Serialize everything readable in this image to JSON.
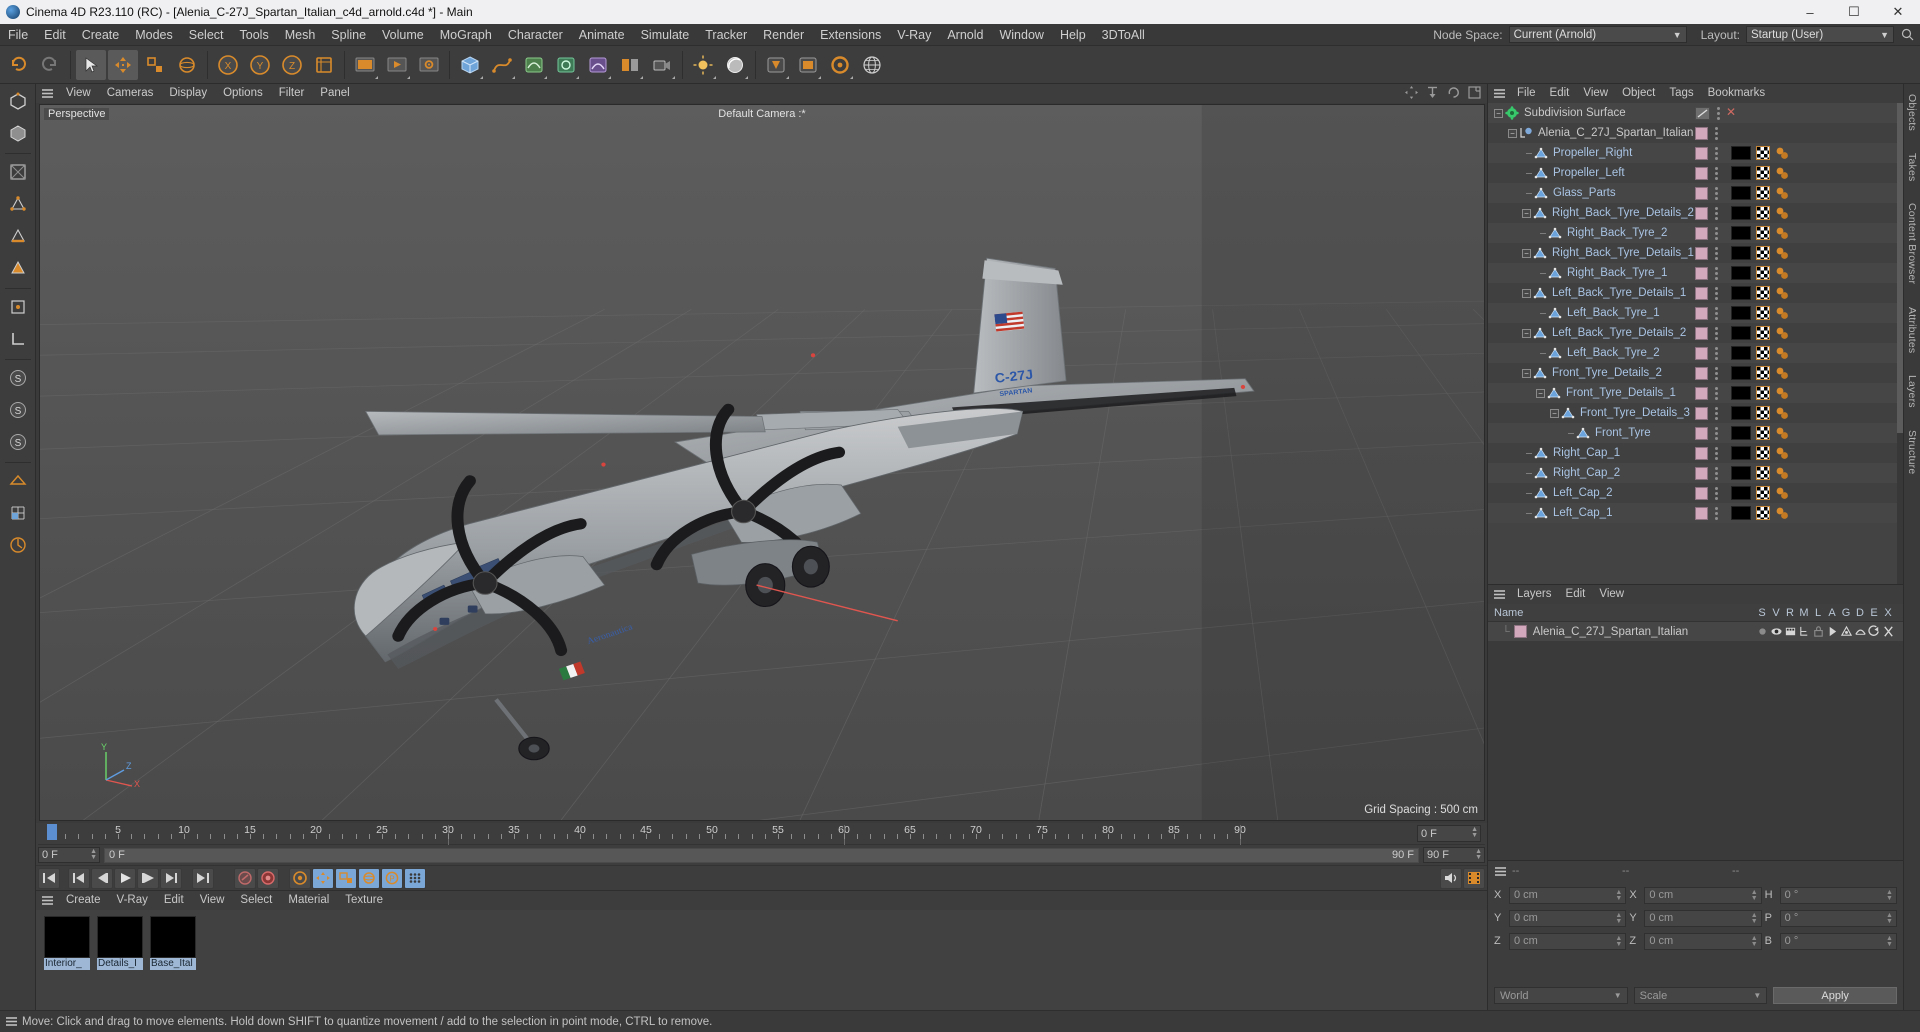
{
  "titlebar": {
    "title": "Cinema 4D R23.110 (RC) - [Alenia_C-27J_Spartan_Italian_c4d_arnold.c4d *] - Main",
    "minimize": "–",
    "maximize": "☐",
    "close": "✕"
  },
  "menubar": {
    "items": [
      "File",
      "Edit",
      "Create",
      "Modes",
      "Select",
      "Tools",
      "Mesh",
      "Spline",
      "Volume",
      "MoGraph",
      "Character",
      "Animate",
      "Simulate",
      "Tracker",
      "Render",
      "Extensions",
      "V-Ray",
      "Arnold",
      "Window",
      "Help",
      "3DToAll"
    ],
    "node_space_label": "Node Space:",
    "node_space_value": "Current (Arnold)",
    "layout_label": "Layout:",
    "layout_value": "Startup (User)"
  },
  "viewport": {
    "menu": [
      "View",
      "Cameras",
      "Display",
      "Options",
      "Filter",
      "Panel"
    ],
    "tag_left": "Perspective",
    "tag_center": "Default Camera :*",
    "grid_spacing": "Grid Spacing : 500 cm",
    "axis": {
      "x": "X",
      "y": "Y",
      "z": "Z"
    }
  },
  "timeline": {
    "labels": [
      "0",
      "5",
      "10",
      "15",
      "20",
      "25",
      "30",
      "35",
      "40",
      "45",
      "50",
      "55",
      "60",
      "65",
      "70",
      "75",
      "80",
      "85",
      "90"
    ],
    "start_frame": "0 F",
    "current_frame": "0 F",
    "range_left": "0 F",
    "range_right": "90 F",
    "end_frame": "90 F",
    "preview_end": "90 F",
    "field_right": "0 F"
  },
  "material_manager": {
    "menu": [
      "Create",
      "V-Ray",
      "Edit",
      "View",
      "Select",
      "Material",
      "Texture"
    ],
    "materials": [
      {
        "name": "Interior_"
      },
      {
        "name": "Details_I"
      },
      {
        "name": "Base_Ital"
      }
    ]
  },
  "statusbar": {
    "message": "Move: Click and drag to move elements. Hold down SHIFT to quantize movement / add to the selection in point mode, CTRL to remove."
  },
  "object_manager": {
    "menu": [
      "File",
      "Edit",
      "View",
      "Object",
      "Tags",
      "Bookmarks"
    ],
    "items": [
      {
        "label": "Subdivision Surface",
        "depth": 0,
        "expander": "minus",
        "icon": "subdivision-surface",
        "tags": [
          "greencheck",
          "dots",
          "close"
        ]
      },
      {
        "label": "Alenia_C_27J_Spartan_Italian",
        "depth": 1,
        "expander": "minus",
        "icon": "null-object",
        "tags": [
          "pink",
          "dots"
        ]
      },
      {
        "label": "Propeller_Right",
        "depth": 2,
        "expander": "none",
        "icon": "polygon-object",
        "tags": [
          "pink",
          "dots",
          "black",
          "checker",
          "ball"
        ]
      },
      {
        "label": "Propeller_Left",
        "depth": 2,
        "expander": "none",
        "icon": "polygon-object",
        "tags": [
          "pink",
          "dots",
          "black",
          "checker",
          "ball"
        ]
      },
      {
        "label": "Glass_Parts",
        "depth": 2,
        "expander": "none",
        "icon": "polygon-object",
        "tags": [
          "pink",
          "dots",
          "black",
          "checker",
          "ball"
        ]
      },
      {
        "label": "Right_Back_Tyre_Details_2",
        "depth": 2,
        "expander": "minus",
        "icon": "polygon-object",
        "tags": [
          "pink",
          "dots",
          "black",
          "checker",
          "ball"
        ]
      },
      {
        "label": "Right_Back_Tyre_2",
        "depth": 3,
        "expander": "none",
        "icon": "polygon-object",
        "tags": [
          "pink",
          "dots",
          "black",
          "checker",
          "ball"
        ]
      },
      {
        "label": "Right_Back_Tyre_Details_1",
        "depth": 2,
        "expander": "minus",
        "icon": "polygon-object",
        "tags": [
          "pink",
          "dots",
          "black",
          "checker",
          "ball"
        ]
      },
      {
        "label": "Right_Back_Tyre_1",
        "depth": 3,
        "expander": "none",
        "icon": "polygon-object",
        "tags": [
          "pink",
          "dots",
          "black",
          "checker",
          "ball"
        ]
      },
      {
        "label": "Left_Back_Tyre_Details_1",
        "depth": 2,
        "expander": "minus",
        "icon": "polygon-object",
        "tags": [
          "pink",
          "dots",
          "black",
          "checker",
          "ball"
        ]
      },
      {
        "label": "Left_Back_Tyre_1",
        "depth": 3,
        "expander": "none",
        "icon": "polygon-object",
        "tags": [
          "pink",
          "dots",
          "black",
          "checker",
          "ball"
        ]
      },
      {
        "label": "Left_Back_Tyre_Details_2",
        "depth": 2,
        "expander": "minus",
        "icon": "polygon-object",
        "tags": [
          "pink",
          "dots",
          "black",
          "checker",
          "ball"
        ]
      },
      {
        "label": "Left_Back_Tyre_2",
        "depth": 3,
        "expander": "none",
        "icon": "polygon-object",
        "tags": [
          "pink",
          "dots",
          "black",
          "checker",
          "ball"
        ]
      },
      {
        "label": "Front_Tyre_Details_2",
        "depth": 2,
        "expander": "minus",
        "icon": "polygon-object",
        "tags": [
          "pink",
          "dots",
          "black",
          "checker",
          "ball"
        ]
      },
      {
        "label": "Front_Tyre_Details_1",
        "depth": 3,
        "expander": "minus",
        "icon": "polygon-object",
        "tags": [
          "pink",
          "dots",
          "black",
          "checker",
          "ball"
        ]
      },
      {
        "label": "Front_Tyre_Details_3",
        "depth": 4,
        "expander": "minus",
        "icon": "polygon-object",
        "tags": [
          "pink",
          "dots",
          "black",
          "checker",
          "ball"
        ]
      },
      {
        "label": "Front_Tyre",
        "depth": 5,
        "expander": "none",
        "icon": "polygon-object",
        "tags": [
          "pink",
          "dots",
          "black",
          "checker",
          "ball"
        ]
      },
      {
        "label": "Right_Cap_1",
        "depth": 2,
        "expander": "none",
        "icon": "polygon-object",
        "tags": [
          "pink",
          "dots",
          "black",
          "checker",
          "ball"
        ]
      },
      {
        "label": "Right_Cap_2",
        "depth": 2,
        "expander": "none",
        "icon": "polygon-object",
        "tags": [
          "pink",
          "dots",
          "black",
          "checker",
          "ball"
        ]
      },
      {
        "label": "Left_Cap_2",
        "depth": 2,
        "expander": "none",
        "icon": "polygon-object",
        "tags": [
          "pink",
          "dots",
          "black",
          "checker",
          "ball"
        ]
      },
      {
        "label": "Left_Cap_1",
        "depth": 2,
        "expander": "none",
        "icon": "polygon-object",
        "tags": [
          "pink",
          "dots",
          "black",
          "checker",
          "ball"
        ]
      }
    ]
  },
  "layers_manager": {
    "menu": [
      "Layers",
      "Edit",
      "View"
    ],
    "name_header": "Name",
    "columns": [
      "S",
      "V",
      "R",
      "M",
      "L",
      "A",
      "G",
      "D",
      "E",
      "X"
    ],
    "rows": [
      {
        "name": "Alenia_C_27J_Spartan_Italian"
      }
    ]
  },
  "coordinates": {
    "header": [
      "--",
      "--",
      "--"
    ],
    "rows": [
      {
        "a_label": "X",
        "a_value": "0 cm",
        "b_label": "X",
        "b_value": "0 cm",
        "c_label": "H",
        "c_value": "0 °"
      },
      {
        "a_label": "Y",
        "a_value": "0 cm",
        "b_label": "Y",
        "b_value": "0 cm",
        "c_label": "P",
        "c_value": "0 °"
      },
      {
        "a_label": "Z",
        "a_value": "0 cm",
        "b_label": "Z",
        "b_value": "0 cm",
        "c_label": "B",
        "c_value": "0 °"
      }
    ],
    "system": "World",
    "mode": "Scale",
    "apply": "Apply"
  },
  "right_tabs": [
    "Objects",
    "Takes",
    "Content Browser",
    "Attributes",
    "Layers",
    "Structure"
  ],
  "colors": {
    "accent_blue": "#7ba7d7",
    "accent_orange": "#d98b2b",
    "tag_pink": "#d2a8bd",
    "panel_bg": "#3d3d3d",
    "viewport_bg": "#525252"
  }
}
